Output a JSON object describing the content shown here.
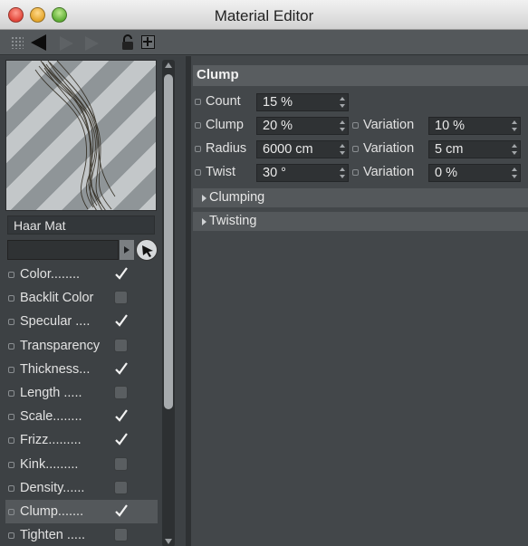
{
  "window": {
    "title": "Material Editor",
    "colors": {
      "panel": "#424649",
      "field": "#2f3234",
      "header": "#595d60",
      "selected": "#54585b"
    }
  },
  "toolbar": {
    "icons": [
      "grip-icon",
      "back-arrow-icon",
      "forward-arrow-icon",
      "forward-arrow-icon",
      "lock-icon",
      "new-window-icon"
    ]
  },
  "left_panel": {
    "material_name": "Haar Mat",
    "channels": [
      {
        "label": "Color........",
        "checked": true
      },
      {
        "label": "Backlit Color",
        "checked": false
      },
      {
        "label": "Specular ....",
        "checked": true
      },
      {
        "label": "Transparency",
        "checked": false
      },
      {
        "label": "Thickness...",
        "checked": true
      },
      {
        "label": "Length .....",
        "checked": false
      },
      {
        "label": "Scale........",
        "checked": true
      },
      {
        "label": "Frizz.........",
        "checked": true
      },
      {
        "label": "Kink.........",
        "checked": false
      },
      {
        "label": "Density......",
        "checked": false
      },
      {
        "label": "Clump.......",
        "checked": true,
        "selected": true
      },
      {
        "label": "Tighten .....",
        "checked": false
      }
    ]
  },
  "right_panel": {
    "section_title": "Clump",
    "params": {
      "count": {
        "label": "Count",
        "value": "15 %"
      },
      "clump": {
        "label": "Clump",
        "value": "20 %"
      },
      "radius": {
        "label": "Radius",
        "value": "6000 cm"
      },
      "twist": {
        "label": "Twist",
        "value": "30 °"
      }
    },
    "variations": {
      "clump": {
        "label": "Variation",
        "value": "10 %"
      },
      "radius": {
        "label": "Variation",
        "value": "5 cm"
      },
      "twist": {
        "label": "Variation",
        "value": "0 %"
      }
    },
    "groups": [
      "Clumping",
      "Twisting"
    ]
  }
}
